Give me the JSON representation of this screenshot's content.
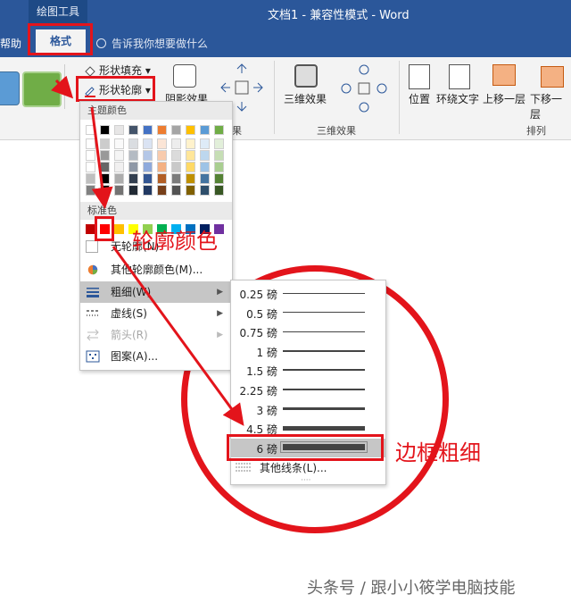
{
  "titlebar": {
    "context_group": "绘图工具",
    "doc_title": "文档1  -  兼容性模式  -  Word"
  },
  "tabs": {
    "help": "帮助",
    "format": "格式",
    "tell_me": "告诉我你想要做什么"
  },
  "ribbon": {
    "shape_fill": "形状填充",
    "shape_outline": "形状轮廓",
    "shadow_effects": "阴影效果",
    "three_d_effects": "三维效果",
    "three_d_group": "三维效果",
    "position": "位置",
    "wrap_text": "环绕文字",
    "bring_forward": "上移一层",
    "send_backward": "下移一层",
    "arrange_group": "排列",
    "truncated_group": "果"
  },
  "outline_menu": {
    "theme_colors_header": "主题颜色",
    "standard_colors_header": "标准色",
    "no_outline": "无轮廓(N)",
    "more_colors": "其他轮廓颜色(M)...",
    "weight": "粗细(W)",
    "dashes": "虚线(S)",
    "arrows": "箭头(R)",
    "pattern": "图案(A)...",
    "theme_top_colors": [
      "#ffffff",
      "#000000",
      "#e7e6e6",
      "#44546a",
      "#4472c4",
      "#ed7d31",
      "#a5a5a5",
      "#ffc000",
      "#5b9bd5",
      "#70ad47"
    ],
    "standard_colors": [
      "#c00000",
      "#ff0000",
      "#ffc000",
      "#ffff00",
      "#92d050",
      "#00b050",
      "#00b0f0",
      "#0070c0",
      "#002060",
      "#7030a0"
    ]
  },
  "weight_menu": {
    "items": [
      "0.25 磅",
      "0.5 磅",
      "0.75 磅",
      "1 磅",
      "1.5 磅",
      "2.25 磅",
      "3 磅",
      "4.5 磅",
      "6 磅"
    ],
    "selected": "6 磅",
    "more_lines": "其他线条(L)..."
  },
  "annotations": {
    "outline_color": "轮廓颜色",
    "border_weight": "边框粗细"
  },
  "watermark": "头条号 / 跟小小筱学电脑技能"
}
